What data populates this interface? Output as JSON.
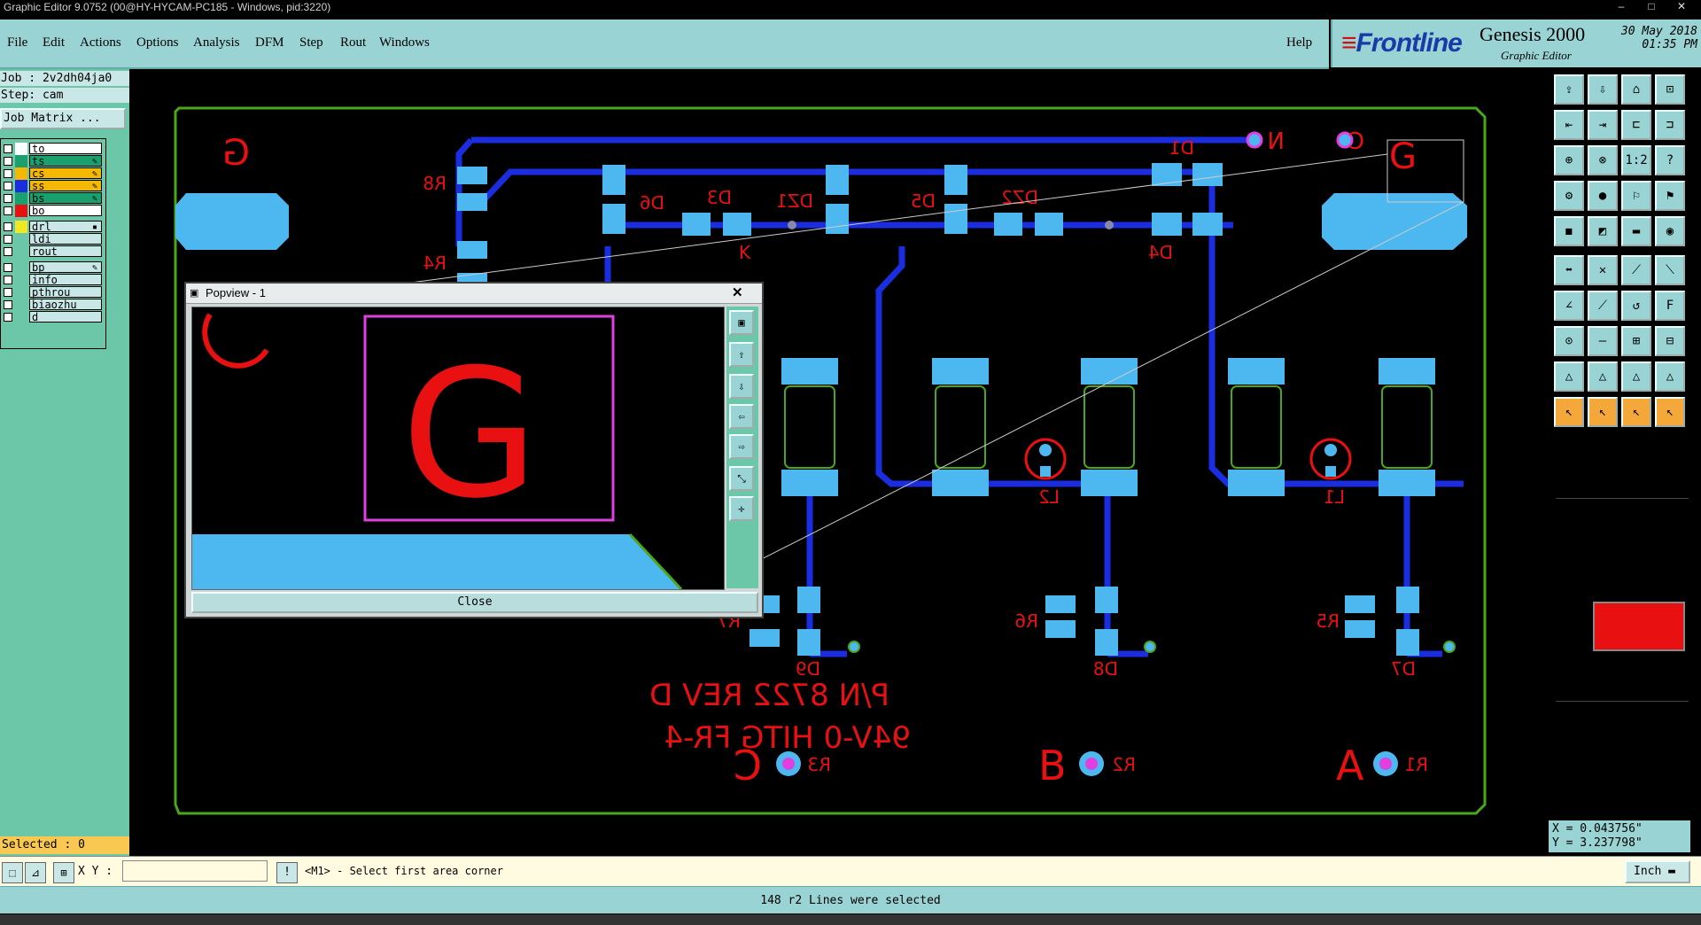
{
  "window": {
    "title": "Graphic Editor 9.0752 (00@HY-HYCAM-PC185 - Windows, pid:3220)"
  },
  "menu": {
    "items": [
      "File",
      "Edit",
      "Actions",
      "Options",
      "Analysis",
      "DFM",
      "Step",
      "Rout",
      "Windows"
    ],
    "help": "Help"
  },
  "brand": {
    "logo": "Frontline",
    "product": "Genesis 2000",
    "subtitle": "Graphic Editor",
    "date": "30 May 2018",
    "time": "01:35 PM"
  },
  "job": {
    "job_line": "Job : 2v2dh04ja0",
    "step_line": "Step: cam",
    "matrix_button": "Job Matrix ..."
  },
  "layers": [
    {
      "name": "to",
      "color": "#ffffff",
      "row_bg": "#ffffff",
      "mark": ""
    },
    {
      "name": "ts",
      "color": "#1aa06e",
      "row_bg": "#1aa06e",
      "mark": "✎"
    },
    {
      "name": "cs",
      "color": "#f5b800",
      "row_bg": "#f5b800",
      "mark": "✎"
    },
    {
      "name": "ss",
      "color": "#1a2ee0",
      "row_bg": "#f5b800",
      "mark": "✎"
    },
    {
      "name": "bs",
      "color": "#1aa06e",
      "row_bg": "#1aa06e",
      "mark": "✎"
    },
    {
      "name": "bo",
      "color": "#e81010",
      "row_bg": "#ffffff",
      "mark": ""
    },
    {
      "name": "drl",
      "color": "#f0e820",
      "row_bg": "#c9e7e7",
      "mark": "▪"
    },
    {
      "name": "ldi",
      "color": "",
      "row_bg": "#c9e7e7",
      "mark": ""
    },
    {
      "name": "rout",
      "color": "",
      "row_bg": "#c9e7e7",
      "mark": ""
    },
    {
      "name": "bp",
      "color": "",
      "row_bg": "#c9e7e7",
      "mark": "✎"
    },
    {
      "name": "info",
      "color": "",
      "row_bg": "#c9e7e7",
      "mark": ""
    },
    {
      "name": "pthrou",
      "color": "",
      "row_bg": "#c9e7e7",
      "mark": ""
    },
    {
      "name": "biaozhu",
      "color": "",
      "row_bg": "#c9e7e7",
      "mark": ""
    },
    {
      "name": "d",
      "color": "",
      "row_bg": "#c9e7e7",
      "mark": ""
    }
  ],
  "selected_label": "Selected : 0",
  "board": {
    "designators": [
      "R8",
      "R4",
      "D6",
      "D3",
      "DZ1",
      "D5",
      "DZ2",
      "D1",
      "D4",
      "L2",
      "L1",
      "R7",
      "R6",
      "R5",
      "D9",
      "D8",
      "D7",
      "R3",
      "R2",
      "R1"
    ],
    "corner_letters": [
      "G",
      "G"
    ],
    "net_labels": [
      "N",
      "C"
    ],
    "pad_letters": [
      "K"
    ],
    "text_line1": "P/N 8722 REV D",
    "text_line2": "94V-0 HITG FR-4",
    "big_letters": [
      "C",
      "B",
      "A"
    ]
  },
  "popup": {
    "title": "Popview - 1",
    "close_label": "Close",
    "big_letter": "G"
  },
  "coords": {
    "x": "X = 0.043756\"",
    "y": "Y = 3.237798\""
  },
  "command": {
    "xy_label": "X Y :",
    "xy_value": "",
    "prompt": "<M1> - Select first area corner",
    "units": "Inch"
  },
  "status_message": "148 r2 Lines were selected",
  "colors": {
    "pad": "#4db8f0",
    "trace": "#1a2ee0",
    "silk": "#e81010",
    "outline": "#4aa818",
    "mark": "#e040e0"
  }
}
